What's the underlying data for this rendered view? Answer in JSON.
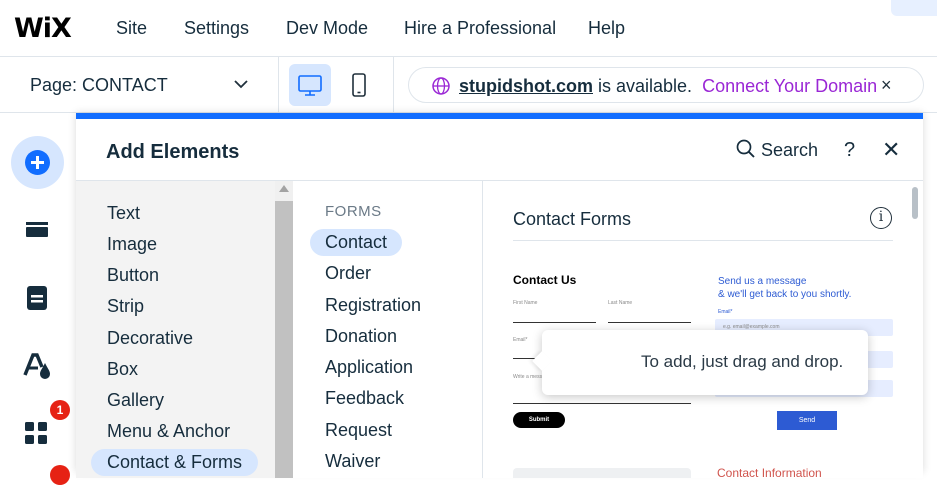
{
  "topbar": {
    "logo": "WiX",
    "menu": [
      "Site",
      "Settings",
      "Dev Mode",
      "Hire a Professional",
      "Help"
    ]
  },
  "secondbar": {
    "page_label": "Page: CONTACT",
    "domain_name": "stupidshot.com",
    "domain_available": " is available.",
    "domain_link": "Connect Your Domain",
    "domain_close": "×"
  },
  "leftbar": {
    "apps_badge": "1"
  },
  "panel": {
    "title": "Add Elements",
    "search_label": "Search",
    "help": "?",
    "close": "✕",
    "categories": [
      "Text",
      "Image",
      "Button",
      "Strip",
      "Decorative",
      "Box",
      "Gallery",
      "Menu & Anchor",
      "Contact & Forms"
    ],
    "selected_category": "Contact & Forms",
    "sub_heading": "FORMS",
    "sub_items": [
      "Contact",
      "Order",
      "Registration",
      "Donation",
      "Application",
      "Feedback",
      "Request",
      "Waiver"
    ],
    "selected_sub_item": "Contact",
    "preview_title": "Contact Forms",
    "info": "i"
  },
  "preview_form_1": {
    "title": "Contact Us",
    "first_name": "First Name",
    "last_name": "Last Name",
    "email": "Email*",
    "message": "Write a message",
    "submit": "Submit"
  },
  "preview_form_2": {
    "line1": "Send us a message",
    "line2": "& we'll get back to you shortly.",
    "email_label": "Email*",
    "email_placeholder": "e.g. email@example.com",
    "send": "Send",
    "bottom_hint": "Contact Information"
  },
  "tooltip": {
    "text": "To add, just drag and drop."
  },
  "colors": {
    "accent": "#116dff",
    "accent_light": "#d6e6fe",
    "domain_link": "#9a27d5",
    "badge": "#e62214"
  }
}
